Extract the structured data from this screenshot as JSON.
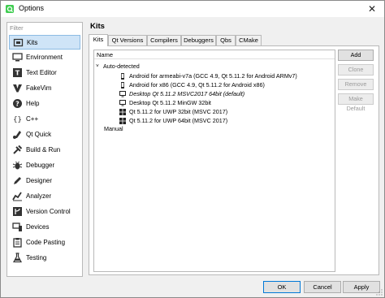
{
  "window": {
    "title": "Options",
    "close_glyph": "✕"
  },
  "filter": {
    "placeholder": "Filter"
  },
  "sidebar": {
    "items": [
      {
        "label": "Kits",
        "icon": "kits-icon",
        "selected": true
      },
      {
        "label": "Environment",
        "icon": "monitor-icon"
      },
      {
        "label": "Text Editor",
        "icon": "text-editor-icon"
      },
      {
        "label": "FakeVim",
        "icon": "fakevim-icon"
      },
      {
        "label": "Help",
        "icon": "help-icon"
      },
      {
        "label": "C++",
        "icon": "braces-icon"
      },
      {
        "label": "Qt Quick",
        "icon": "qt-quick-icon"
      },
      {
        "label": "Build & Run",
        "icon": "build-run-icon"
      },
      {
        "label": "Debugger",
        "icon": "bug-icon"
      },
      {
        "label": "Designer",
        "icon": "pen-icon"
      },
      {
        "label": "Analyzer",
        "icon": "chart-icon"
      },
      {
        "label": "Version Control",
        "icon": "version-control-icon"
      },
      {
        "label": "Devices",
        "icon": "devices-icon"
      },
      {
        "label": "Code Pasting",
        "icon": "clipboard-icon"
      },
      {
        "label": "Testing",
        "icon": "testing-icon"
      }
    ]
  },
  "page": {
    "title": "Kits"
  },
  "tabs": [
    "Kits",
    "Qt Versions",
    "Compilers",
    "Debuggers",
    "Qbs",
    "CMake"
  ],
  "tree": {
    "header": "Name",
    "auto_detected": "Auto-detected",
    "kits": [
      {
        "label": "Android for armeabi-v7a (GCC 4.9, Qt 5.11.2 for Android ARMv7)",
        "icon": "android-device-icon",
        "italic": false
      },
      {
        "label": "Android for x86 (GCC 4.9, Qt 5.11.2 for Android x86)",
        "icon": "android-device-icon",
        "italic": false
      },
      {
        "label": "Desktop Qt 5.11.2 MSVC2017 64bit (default)",
        "icon": "desktop-icon",
        "italic": true
      },
      {
        "label": "Desktop Qt 5.11.2 MinGW 32bit",
        "icon": "desktop-icon",
        "italic": false
      },
      {
        "label": "Qt 5.11.2 for UWP 32bit (MSVC 2017)",
        "icon": "windows-icon",
        "italic": false
      },
      {
        "label": "Qt 5.11.2 for UWP 64bit (MSVC 2017)",
        "icon": "windows-icon",
        "italic": false
      }
    ],
    "manual": "Manual"
  },
  "side_buttons": {
    "add": "Add",
    "clone": "Clone",
    "remove": "Remove",
    "make_default": "Make Default"
  },
  "bottom_buttons": {
    "ok": "OK",
    "cancel": "Cancel",
    "apply": "Apply"
  },
  "colors": {
    "selection": "#cfe4f7",
    "accent": "#0078d7",
    "qt_green": "#41cd52"
  }
}
